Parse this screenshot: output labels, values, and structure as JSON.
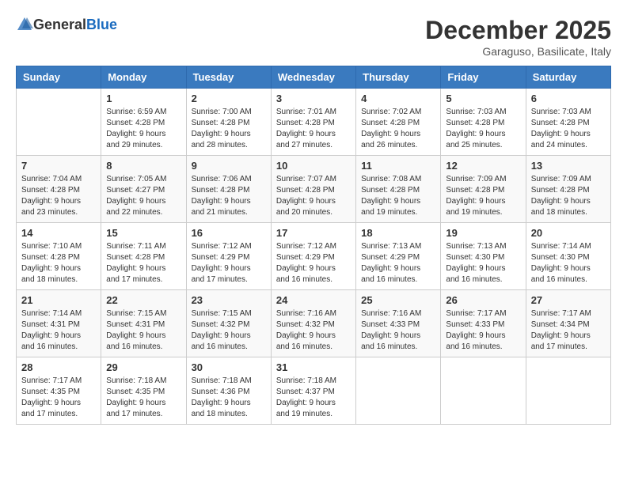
{
  "header": {
    "logo_general": "General",
    "logo_blue": "Blue",
    "month_title": "December 2025",
    "subtitle": "Garaguso, Basilicate, Italy"
  },
  "weekdays": [
    "Sunday",
    "Monday",
    "Tuesday",
    "Wednesday",
    "Thursday",
    "Friday",
    "Saturday"
  ],
  "weeks": [
    [
      {
        "day": "",
        "info": ""
      },
      {
        "day": "1",
        "info": "Sunrise: 6:59 AM\nSunset: 4:28 PM\nDaylight: 9 hours\nand 29 minutes."
      },
      {
        "day": "2",
        "info": "Sunrise: 7:00 AM\nSunset: 4:28 PM\nDaylight: 9 hours\nand 28 minutes."
      },
      {
        "day": "3",
        "info": "Sunrise: 7:01 AM\nSunset: 4:28 PM\nDaylight: 9 hours\nand 27 minutes."
      },
      {
        "day": "4",
        "info": "Sunrise: 7:02 AM\nSunset: 4:28 PM\nDaylight: 9 hours\nand 26 minutes."
      },
      {
        "day": "5",
        "info": "Sunrise: 7:03 AM\nSunset: 4:28 PM\nDaylight: 9 hours\nand 25 minutes."
      },
      {
        "day": "6",
        "info": "Sunrise: 7:03 AM\nSunset: 4:28 PM\nDaylight: 9 hours\nand 24 minutes."
      }
    ],
    [
      {
        "day": "7",
        "info": "Sunrise: 7:04 AM\nSunset: 4:28 PM\nDaylight: 9 hours\nand 23 minutes."
      },
      {
        "day": "8",
        "info": "Sunrise: 7:05 AM\nSunset: 4:27 PM\nDaylight: 9 hours\nand 22 minutes."
      },
      {
        "day": "9",
        "info": "Sunrise: 7:06 AM\nSunset: 4:28 PM\nDaylight: 9 hours\nand 21 minutes."
      },
      {
        "day": "10",
        "info": "Sunrise: 7:07 AM\nSunset: 4:28 PM\nDaylight: 9 hours\nand 20 minutes."
      },
      {
        "day": "11",
        "info": "Sunrise: 7:08 AM\nSunset: 4:28 PM\nDaylight: 9 hours\nand 19 minutes."
      },
      {
        "day": "12",
        "info": "Sunrise: 7:09 AM\nSunset: 4:28 PM\nDaylight: 9 hours\nand 19 minutes."
      },
      {
        "day": "13",
        "info": "Sunrise: 7:09 AM\nSunset: 4:28 PM\nDaylight: 9 hours\nand 18 minutes."
      }
    ],
    [
      {
        "day": "14",
        "info": "Sunrise: 7:10 AM\nSunset: 4:28 PM\nDaylight: 9 hours\nand 18 minutes."
      },
      {
        "day": "15",
        "info": "Sunrise: 7:11 AM\nSunset: 4:28 PM\nDaylight: 9 hours\nand 17 minutes."
      },
      {
        "day": "16",
        "info": "Sunrise: 7:12 AM\nSunset: 4:29 PM\nDaylight: 9 hours\nand 17 minutes."
      },
      {
        "day": "17",
        "info": "Sunrise: 7:12 AM\nSunset: 4:29 PM\nDaylight: 9 hours\nand 16 minutes."
      },
      {
        "day": "18",
        "info": "Sunrise: 7:13 AM\nSunset: 4:29 PM\nDaylight: 9 hours\nand 16 minutes."
      },
      {
        "day": "19",
        "info": "Sunrise: 7:13 AM\nSunset: 4:30 PM\nDaylight: 9 hours\nand 16 minutes."
      },
      {
        "day": "20",
        "info": "Sunrise: 7:14 AM\nSunset: 4:30 PM\nDaylight: 9 hours\nand 16 minutes."
      }
    ],
    [
      {
        "day": "21",
        "info": "Sunrise: 7:14 AM\nSunset: 4:31 PM\nDaylight: 9 hours\nand 16 minutes."
      },
      {
        "day": "22",
        "info": "Sunrise: 7:15 AM\nSunset: 4:31 PM\nDaylight: 9 hours\nand 16 minutes."
      },
      {
        "day": "23",
        "info": "Sunrise: 7:15 AM\nSunset: 4:32 PM\nDaylight: 9 hours\nand 16 minutes."
      },
      {
        "day": "24",
        "info": "Sunrise: 7:16 AM\nSunset: 4:32 PM\nDaylight: 9 hours\nand 16 minutes."
      },
      {
        "day": "25",
        "info": "Sunrise: 7:16 AM\nSunset: 4:33 PM\nDaylight: 9 hours\nand 16 minutes."
      },
      {
        "day": "26",
        "info": "Sunrise: 7:17 AM\nSunset: 4:33 PM\nDaylight: 9 hours\nand 16 minutes."
      },
      {
        "day": "27",
        "info": "Sunrise: 7:17 AM\nSunset: 4:34 PM\nDaylight: 9 hours\nand 17 minutes."
      }
    ],
    [
      {
        "day": "28",
        "info": "Sunrise: 7:17 AM\nSunset: 4:35 PM\nDaylight: 9 hours\nand 17 minutes."
      },
      {
        "day": "29",
        "info": "Sunrise: 7:18 AM\nSunset: 4:35 PM\nDaylight: 9 hours\nand 17 minutes."
      },
      {
        "day": "30",
        "info": "Sunrise: 7:18 AM\nSunset: 4:36 PM\nDaylight: 9 hours\nand 18 minutes."
      },
      {
        "day": "31",
        "info": "Sunrise: 7:18 AM\nSunset: 4:37 PM\nDaylight: 9 hours\nand 19 minutes."
      },
      {
        "day": "",
        "info": ""
      },
      {
        "day": "",
        "info": ""
      },
      {
        "day": "",
        "info": ""
      }
    ]
  ]
}
